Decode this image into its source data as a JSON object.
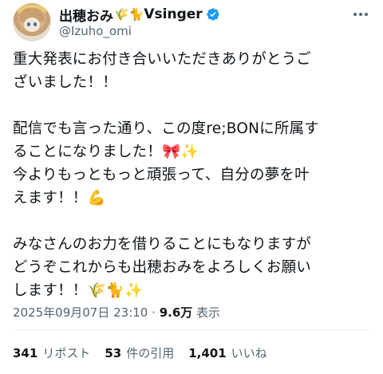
{
  "author": {
    "display_name": "出穂おみ",
    "name_emojis": "🌾🐈",
    "name_suffix": "Vsinger",
    "handle": "@Izuho_omi",
    "verified": true,
    "verified_color": "#1d9bf0"
  },
  "tweet": {
    "text": "重大発表にお付き合いいただきありがとうご\nざいました！！\n\n配信でも言った通り、この度re;BONに所属す\nることになりました！🎀✨\n今よりもっともっと頑張って、自分の夢を叶\nえます！！💪\n\nみなさんのお力を借りることにもなりますが\nどうぞこれからも出穂おみをよろしくお願い\nします！！🌾🐈✨",
    "timestamp": "2025年09月07日 23:10",
    "separator": "·",
    "views": "9.6万",
    "views_label": "表示"
  },
  "stats": {
    "reposts_count": "341",
    "reposts_label": "リポスト",
    "quotes_count": "53",
    "quotes_label": "件の引用",
    "likes_count": "1,401",
    "likes_label": "いいね"
  },
  "icons": {
    "avatar": "avatar-image",
    "verified": "verified-badge-icon",
    "more": "more-options-icon"
  }
}
